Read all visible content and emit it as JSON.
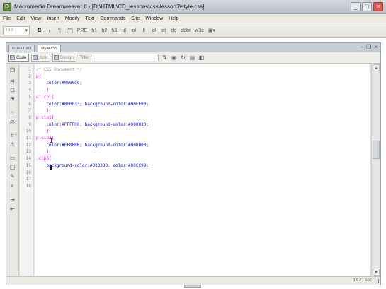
{
  "window": {
    "title": "Macromedia Dreamweaver 8 - [D:\\HTML\\CD_lessons\\css\\lesson3\\style.css]",
    "app_icon": "dreamweaver-logo",
    "buttons": [
      "_",
      "□",
      "×"
    ]
  },
  "menu": [
    "File",
    "Edit",
    "View",
    "Insert",
    "Modify",
    "Text",
    "Commands",
    "Site",
    "Window",
    "Help"
  ],
  "toolbar": {
    "format_select": "Text",
    "items": [
      "B",
      "I",
      "¶",
      "[\"\"]",
      "PRE",
      "h1",
      "h2",
      "h3",
      "ul",
      "ol",
      "li",
      "dl",
      "dt",
      "dd",
      "abbr",
      "w3c"
    ]
  },
  "tabs": [
    {
      "label": "index.html",
      "active": false
    },
    {
      "label": "style.css",
      "active": true
    }
  ],
  "doc_toolbar": {
    "views": [
      {
        "label": "Code",
        "active": true
      },
      {
        "label": "Split",
        "active": false
      },
      {
        "label": "Design",
        "active": false
      }
    ],
    "title_label": "Title:",
    "title_value": ""
  },
  "code": {
    "line_numbers": [
      "1",
      "2",
      "3",
      "4",
      "5",
      "6",
      "7",
      "8",
      "9",
      "10",
      "11",
      "12",
      "13",
      "14",
      "15",
      "16",
      "17",
      "18"
    ],
    "lines": [
      {
        "parts": [
          {
            "t": "/* CSS Document */",
            "c": "c-comment"
          }
        ]
      },
      {
        "parts": [
          {
            "t": "p{",
            "c": "c-sel"
          }
        ]
      },
      {
        "parts": [
          {
            "t": "    color:#0000CC;",
            "c": "c-prop"
          }
        ]
      },
      {
        "parts": [
          {
            "t": "    }",
            "c": "c-brace"
          }
        ]
      },
      {
        "parts": [
          {
            "t": "ul.col{",
            "c": "c-sel"
          }
        ]
      },
      {
        "parts": [
          {
            "t": "    color:#000033; background-color:#00FF00;",
            "c": "c-prop"
          }
        ]
      },
      {
        "parts": [
          {
            "t": "    }",
            "c": "c-brace"
          }
        ]
      },
      {
        "parts": [
          {
            "t": "p.clp1{",
            "c": "c-sel"
          }
        ]
      },
      {
        "parts": [
          {
            "t": "    color:#FFFF00; background-color:#000033;",
            "c": "c-prop"
          }
        ]
      },
      {
        "parts": [
          {
            "t": "    }",
            "c": "c-brace"
          }
        ]
      },
      {
        "parts": [
          {
            "t": "p.clp2{",
            "c": "c-sel"
          }
        ]
      },
      {
        "parts": [
          {
            "t": "    color:#FF0000; background-color:#000000;",
            "c": "c-prop"
          }
        ]
      },
      {
        "parts": [
          {
            "t": "    }",
            "c": "c-brace"
          }
        ]
      },
      {
        "parts": [
          {
            "t": ".clp3{",
            "c": "c-sel"
          }
        ]
      },
      {
        "parts": [
          {
            "t": "    background-color:#333333; color:#00CC99;",
            "c": "c-prop"
          }
        ]
      },
      {
        "parts": [
          {
            "t": "",
            "c": "c-prop"
          }
        ]
      },
      {
        "parts": [
          {
            "t": "",
            "c": "c-prop"
          }
        ]
      },
      {
        "parts": [
          {
            "t": "",
            "c": "c-prop"
          }
        ]
      }
    ]
  },
  "status": "1K / 1 sec",
  "coding_toolbar_icons": [
    "open-documents-icon",
    "collapse-tag-icon",
    "collapse-selection-icon",
    "expand-all-icon",
    "select-parent-icon",
    "balance-braces-icon",
    "line-numbers-icon",
    "highlight-invalid-icon",
    "apply-comment-icon",
    "remove-comment-icon",
    "wrap-tag-icon",
    "recent-snippets-icon",
    "indent-icon",
    "outdent-icon"
  ]
}
